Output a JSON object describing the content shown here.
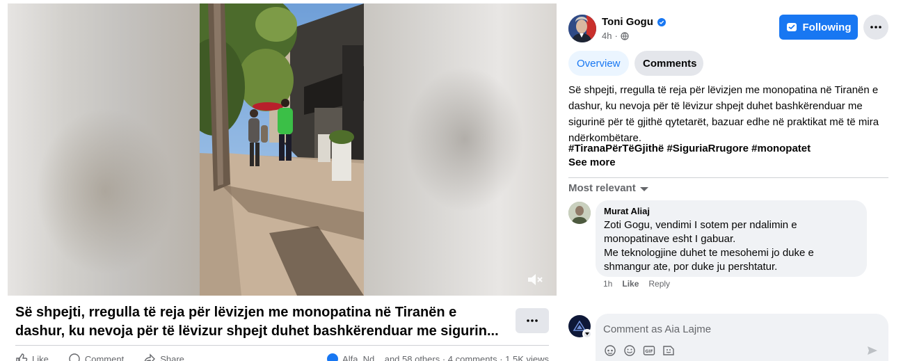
{
  "post": {
    "title_line1": "Së shpejti, rregulla të reja për lëvizjen me monopatina në Tiranën e",
    "title_line2": "dashur, ku nevoja për të lëvizur shpejt duhet bashkërenduar me sigurin...",
    "actions": [
      "Like",
      "Comment",
      "Share"
    ],
    "reactions_text": "Alfa, Nd... and 58 others · 4 comments · 1.5K views"
  },
  "author": {
    "name": "Toni Gogu",
    "time": "4h",
    "follow_label": "Following"
  },
  "tabs": {
    "overview": "Overview",
    "comments": "Comments"
  },
  "description": {
    "text": "Së shpejti, rregulla të reja për lëvizjen me monopatina në Tiranën e dashur, ku nevoja për të lëvizur shpejt duhet bashkërenduar me sigurinë për të gjithë qytetarët, bazuar edhe në praktikat më të mira ndërkombëtare.",
    "hashtags": "#TiranaPërTëGjithë #SiguriaRrugore #monopatet",
    "see_more": "See more"
  },
  "comments": {
    "sort_label": "Most relevant",
    "items": [
      {
        "author": "Murat Aliaj",
        "line1": "Zoti Gogu, vendimi I sotem per ndalimin e",
        "line2": "monopatinave esht I gabuar.",
        "line3": "Me teknologjine duhet te mesohemi jo duke e",
        "line4": "shmangur ate, por duke ju pershtatur.",
        "time": "1h",
        "like": "Like",
        "reply": "Reply"
      }
    ],
    "input_placeholder": "Comment as Aia Lajme"
  },
  "colors": {
    "primary": "#1877f2",
    "secondary_bg": "#e4e6eb",
    "bubble_bg": "#f0f2f5",
    "muted_text": "#65676b"
  },
  "icons": [
    "sound-off-icon",
    "more-icon",
    "verified-icon",
    "globe-icon",
    "messenger-icon",
    "caret-down-icon",
    "sticker-icon",
    "emoji-icon",
    "gif-icon",
    "avatar-sticker-icon",
    "send-icon",
    "like-icon",
    "comment-icon",
    "share-icon"
  ]
}
